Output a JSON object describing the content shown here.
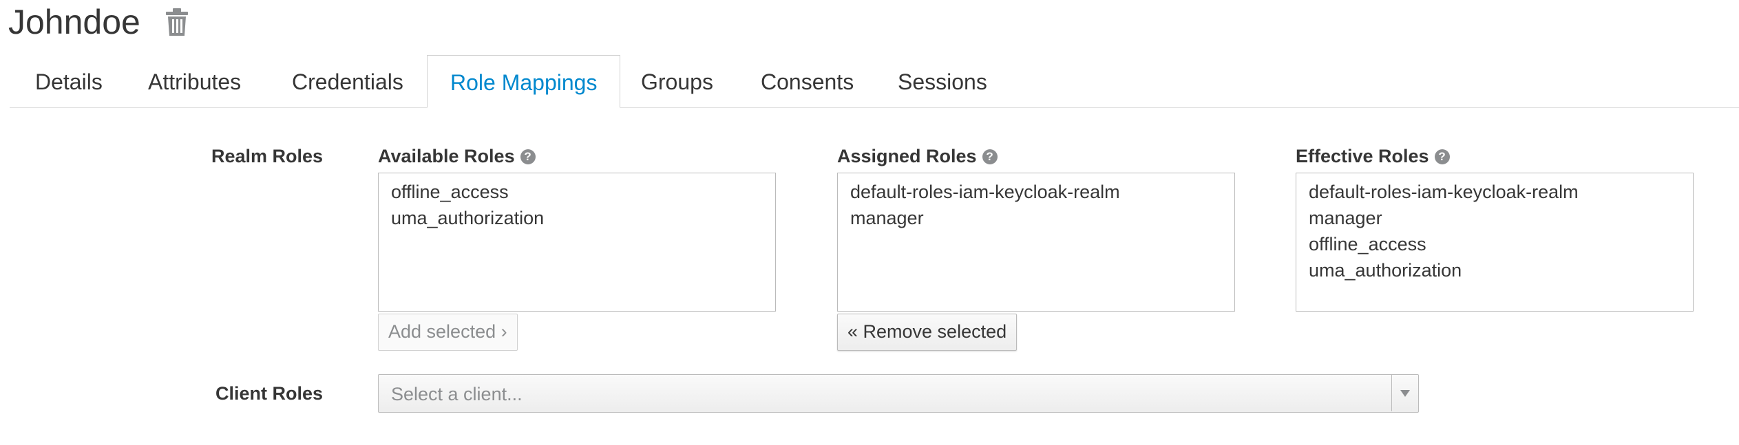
{
  "header": {
    "title": "Johndoe",
    "delete_icon": "trash-icon"
  },
  "tabs": [
    {
      "label": "Details"
    },
    {
      "label": "Attributes"
    },
    {
      "label": "Credentials"
    },
    {
      "label": "Role Mappings",
      "active": true
    },
    {
      "label": "Groups"
    },
    {
      "label": "Consents"
    },
    {
      "label": "Sessions"
    }
  ],
  "realm_roles": {
    "label": "Realm Roles",
    "available": {
      "title": "Available Roles",
      "items": [
        "offline_access",
        "uma_authorization"
      ],
      "button": "Add selected ›"
    },
    "assigned": {
      "title": "Assigned Roles",
      "items": [
        "default-roles-iam-keycloak-realm",
        "manager"
      ],
      "button": "« Remove selected"
    },
    "effective": {
      "title": "Effective Roles",
      "items": [
        "default-roles-iam-keycloak-realm",
        "manager",
        "offline_access",
        "uma_authorization"
      ]
    }
  },
  "client_roles": {
    "label": "Client Roles",
    "placeholder": "Select a client..."
  },
  "colors": {
    "accent": "#0088ce",
    "text": "#363636",
    "muted": "#8b8d8f"
  }
}
